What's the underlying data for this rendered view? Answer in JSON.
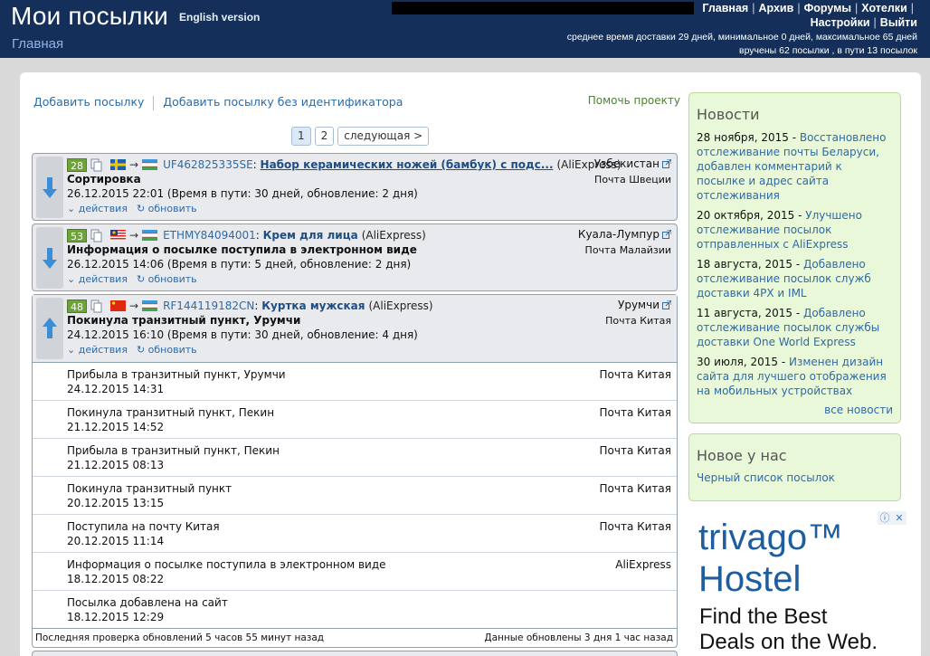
{
  "header": {
    "title": "Мои посылки",
    "english_link": "English version",
    "breadcrumb": "Главная",
    "nav_row1": [
      "Главная",
      "Архив",
      "Форумы",
      "Хотелки",
      ""
    ],
    "nav_row2": [
      "Настройки",
      "Выйти"
    ],
    "stats_line1": "среднее время доставки 29 дней, минимальное 0 дней, максимальное 65 дней",
    "stats_line2": "вручены 62 посылки , в пути 13 посылок"
  },
  "toolbar": {
    "add_parcel": "Добавить посылку",
    "add_without_id": "Добавить посылку без идентификатора",
    "help_project": "Помочь проекту"
  },
  "pager": {
    "pages": [
      "1",
      "2"
    ],
    "next": "следующая >"
  },
  "parcels": [
    {
      "days": "28",
      "from_flag": "flag-sweden-icon",
      "to_flag": "flag-uzbekistan-icon",
      "tracking": "UF462825335SE",
      "title": "Набор керамических ножей (бамбук) с подс...",
      "shop": "(AliExpress)",
      "status": "Сортировка",
      "time": "26.12.2015 22:01 (Время в пути: 30 дней, обновление: 2 дня)",
      "city": "Узбекистан",
      "post": "Почта Швеции",
      "direction": "down"
    },
    {
      "days": "53",
      "from_flag": "flag-malaysia-icon",
      "to_flag": "flag-uzbekistan-icon",
      "tracking": "ETHMY84094001",
      "title": "Крем для лица",
      "shop": "(AliExpress)",
      "status": "Информация о посылке поступила в электронном виде",
      "time": "26.12.2015 14:06 (Время в пути: 5 дней, обновление: 2 дня)",
      "city": "Куала-Лумпур",
      "post": "Почта Малайзии",
      "direction": "down"
    },
    {
      "days": "48",
      "from_flag": "flag-china-icon",
      "to_flag": "flag-uzbekistan-icon",
      "tracking": "RF144119182CN",
      "title": "Куртка мужская",
      "shop": "(AliExpress)",
      "status": "Покинула транзитный пункт, Урумчи",
      "time": "24.12.2015 16:10 (Время в пути: 30 дней, обновление: 4 дня)",
      "city": "Урумчи",
      "post": "Почта Китая",
      "direction": "up"
    }
  ],
  "actions": {
    "actions_label": "действия",
    "refresh_label": "обновить"
  },
  "events": [
    {
      "desc": "Прибыла в транзитный пункт, Урумчи",
      "date": "24.12.2015 14:31",
      "post": "Почта Китая"
    },
    {
      "desc": "Покинула транзитный пункт, Пекин",
      "date": "21.12.2015 14:52",
      "post": "Почта Китая"
    },
    {
      "desc": "Прибыла в транзитный пункт, Пекин",
      "date": "21.12.2015 08:13",
      "post": "Почта Китая"
    },
    {
      "desc": "Покинула транзитный пункт",
      "date": "20.12.2015 13:15",
      "post": "Почта Китая"
    },
    {
      "desc": "Поступила на почту Китая",
      "date": "20.12.2015 11:14",
      "post": "Почта Китая"
    },
    {
      "desc": "Информация о посылке поступила в электронном виде",
      "date": "18.12.2015 08:22",
      "post": "AliExpress"
    },
    {
      "desc": "Посылка добавлена на сайт",
      "date": "18.12.2015 12:29",
      "post": ""
    }
  ],
  "footer": {
    "last_check": "Последняя проверка обновлений 5 часов 55 минут назад",
    "data_updated": "Данные обновлены 3 дня 1 час назад"
  },
  "news": {
    "title": "Новости",
    "items": [
      {
        "date": "28 ноября, 2015 - ",
        "text": "Восстановлено отслеживание почты Беларуси, добавлен комментарий к посылке и адрес сайта отслеживания"
      },
      {
        "date": "20 октября, 2015 - ",
        "text": "Улучшено отслеживание посылок отправленных с AliExpress"
      },
      {
        "date": "18 августа, 2015 - ",
        "text": "Добавлено отслеживание посылок служб доставки 4PX и IML"
      },
      {
        "date": "11 августа, 2015 - ",
        "text": "Добавлено отслеживание посылок службы доставки One World Express"
      },
      {
        "date": "30 июля, 2015 - ",
        "text": "Изменен дизайн сайта для лучшего отображения на мобильных устройствах"
      }
    ],
    "all_news": "все новости"
  },
  "new_box": {
    "title": "Новое у нас",
    "link": "Черный список посылок"
  },
  "ad": {
    "brand_line1": "trivago™",
    "brand_line2": "Hostel",
    "text_line1": "Find the Best",
    "text_line2": "Deals on the Web."
  },
  "colors": {
    "header_bg": "#14305a",
    "badge_green": "#6da338",
    "link_blue": "#2e6aa8",
    "sidebar_bg": "#e9f8d8"
  }
}
